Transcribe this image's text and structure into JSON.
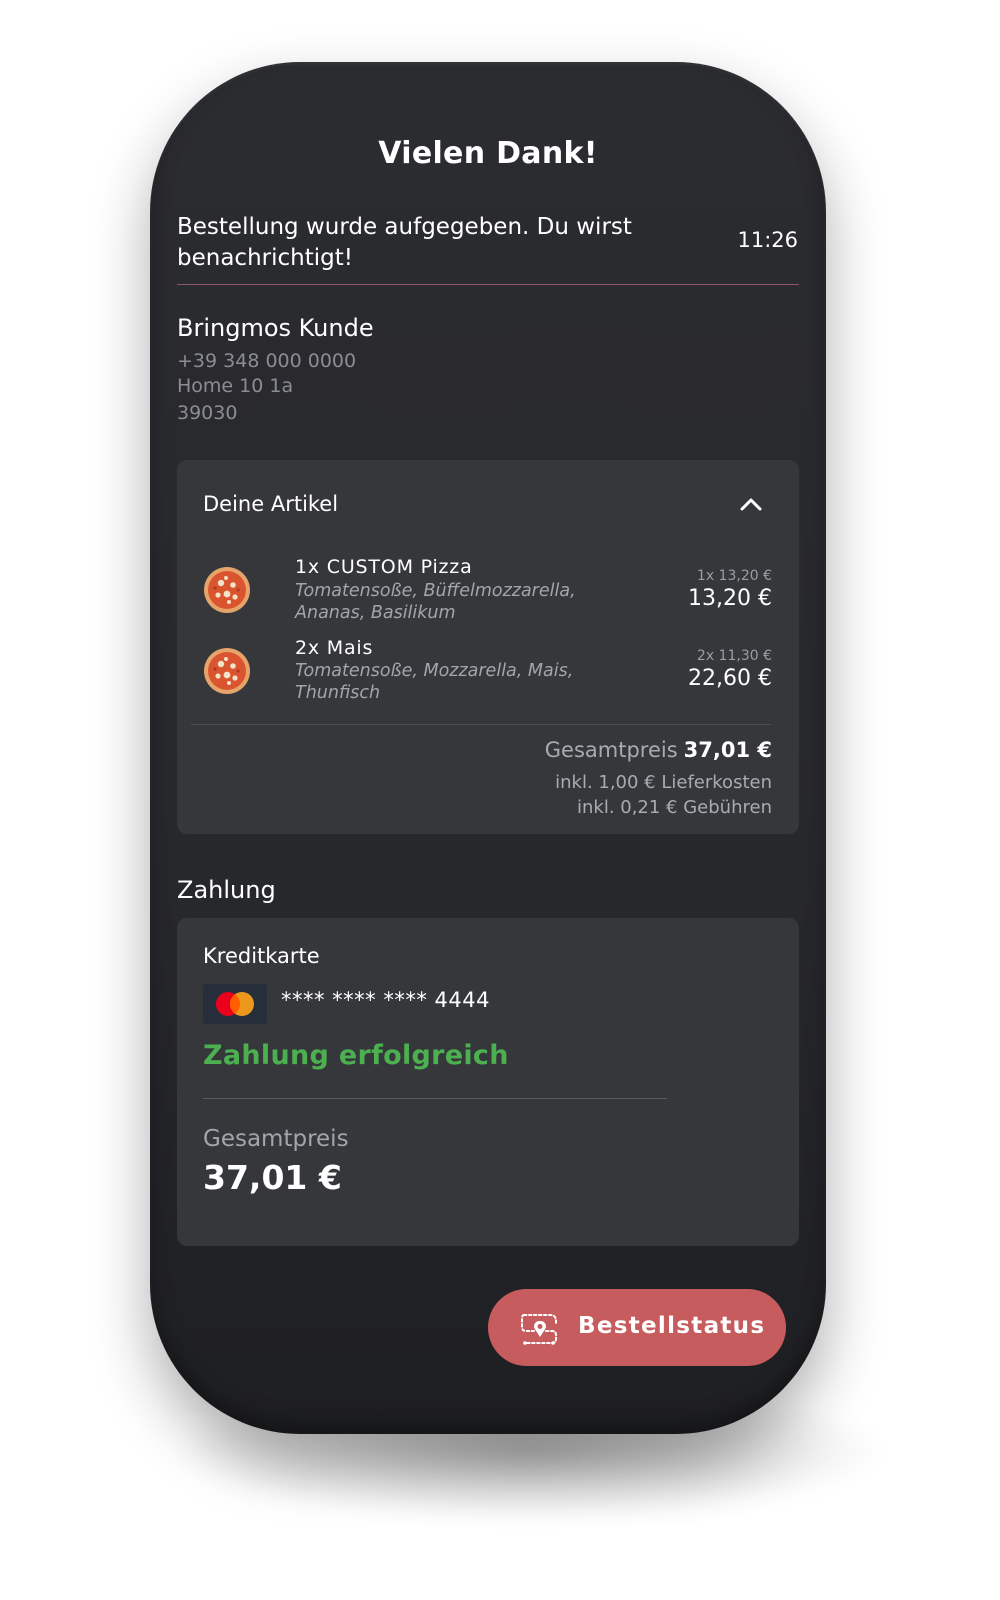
{
  "header": {
    "title": "Vielen Dank!",
    "message": "Bestellung wurde aufgegeben. Du wirst benachrichtigt!",
    "time": "11:26"
  },
  "customer": {
    "name": "Bringmos Kunde",
    "phone": "+39 348 000 0000",
    "address": "Home 10  1a",
    "zip": "39030"
  },
  "articles": {
    "title": "Deine Artikel",
    "items": [
      {
        "name": "1x CUSTOM Pizza",
        "description": "Tomatensoße, Büffelmozzarella, Ananas, Basilikum",
        "unit_price": "1x 13,20 €",
        "total": "13,20 €",
        "icon": "pizza-icon"
      },
      {
        "name": "2x Mais",
        "description": "Tomatensoße, Mozzarella, Mais, Thunfisch",
        "unit_price": "2x 11,30 €",
        "total": "22,60 €",
        "icon": "pizza-icon"
      }
    ],
    "total_label": "Gesamtpreis",
    "total_value": "37,01 €",
    "delivery": "inkl. 1,00 € Lieferkosten",
    "fees": "inkl. 0,21 € Gebühren"
  },
  "payment": {
    "section_label": "Zahlung",
    "method": "Kreditkarte",
    "card_number": "**** **** **** 4444",
    "card_icon": "mastercard-icon",
    "status": "Zahlung erfolgreich",
    "total_label": "Gesamtpreis",
    "total_value": "37,01 €"
  },
  "action": {
    "label": "Bestellstatus",
    "icon": "route-icon"
  },
  "colors": {
    "background": "#27282c",
    "card": "#35373b",
    "accent_button": "#c75c5e",
    "success": "#4caf50",
    "divider": "#8e5a64"
  }
}
